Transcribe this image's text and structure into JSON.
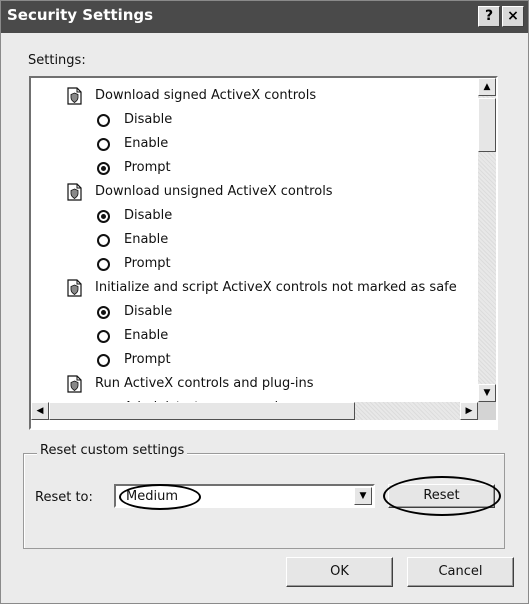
{
  "window": {
    "title": "Security Settings",
    "help_button": "?",
    "close_button": "×"
  },
  "settings_label": "Settings:",
  "settings_list": [
    {
      "type": "policy",
      "label": "Download signed ActiveX controls"
    },
    {
      "type": "option",
      "label": "Disable",
      "selected": false
    },
    {
      "type": "option",
      "label": "Enable",
      "selected": false
    },
    {
      "type": "option",
      "label": "Prompt",
      "selected": true
    },
    {
      "type": "policy",
      "label": "Download unsigned ActiveX controls"
    },
    {
      "type": "option",
      "label": "Disable",
      "selected": true
    },
    {
      "type": "option",
      "label": "Enable",
      "selected": false
    },
    {
      "type": "option",
      "label": "Prompt",
      "selected": false
    },
    {
      "type": "policy",
      "label": "Initialize and script ActiveX controls not marked as safe"
    },
    {
      "type": "option",
      "label": "Disable",
      "selected": true
    },
    {
      "type": "option",
      "label": "Enable",
      "selected": false
    },
    {
      "type": "option",
      "label": "Prompt",
      "selected": false
    },
    {
      "type": "policy",
      "label": "Run ActiveX controls and plug-ins"
    },
    {
      "type": "option",
      "label": "Administrator approved",
      "selected": false
    }
  ],
  "reset_group": {
    "title": "Reset custom settings",
    "reset_to_label": "Reset to:",
    "selected_level": "Medium",
    "reset_button": "Reset"
  },
  "buttons": {
    "ok": "OK",
    "cancel": "Cancel"
  },
  "colors": {
    "titlebar": "#4a4a4a",
    "window_bg": "#ebebeb"
  }
}
